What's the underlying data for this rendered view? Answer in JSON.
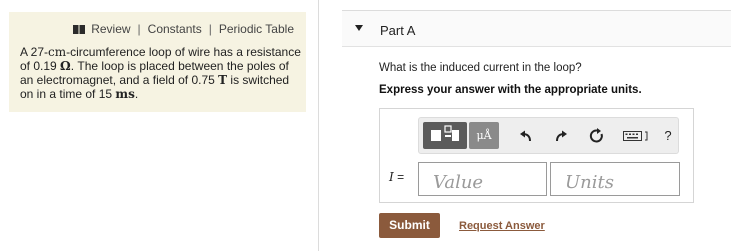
{
  "nav": {
    "review": "Review",
    "separator": "|",
    "constants": "Constants",
    "periodic_table": "Periodic Table"
  },
  "problem": {
    "t1": "A 27-",
    "u_cm": "cm",
    "t2": "-circumference loop of wire has a resistance of 0.19 ",
    "u_ohm": "Ω",
    "t3": ". The loop is placed between the poles of an electromagnet, and a field of 0.75 ",
    "u_T": "T",
    "t4": " is switched on in a time of 15 ",
    "u_ms": "ms",
    "t5": "."
  },
  "part": {
    "title": "Part A"
  },
  "question": "What is the induced current in the loop?",
  "instruction": "Express your answer with the appropriate units.",
  "toolbar": {
    "units_label": "μÅ",
    "help_label": "?",
    "icons": [
      "templates-icon",
      "units-icon",
      "undo-icon",
      "redo-icon",
      "reset-icon",
      "keyboard-icon",
      "help-icon"
    ]
  },
  "answer": {
    "variable": "I",
    "equals": " =",
    "value_placeholder": "Value",
    "units_placeholder": "Units"
  },
  "buttons": {
    "submit": "Submit",
    "request_answer": "Request Answer"
  },
  "colors": {
    "panel_bg": "#f6f3e2",
    "submit_bg": "#8b5a3c",
    "link": "#8b5a3c"
  }
}
